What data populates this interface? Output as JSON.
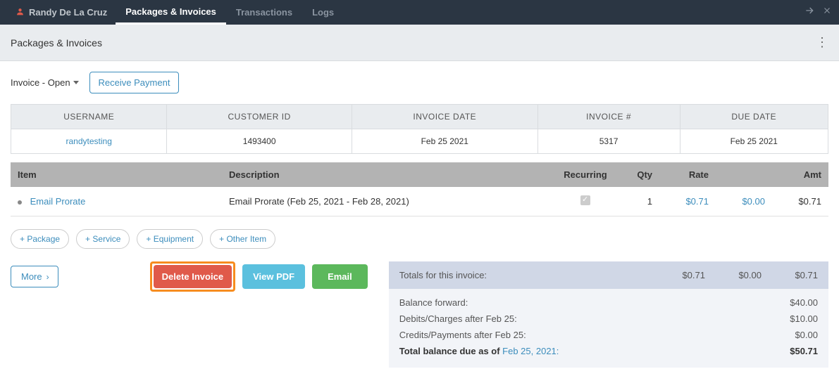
{
  "nav": {
    "user_name": "Randy De La Cruz",
    "tabs": [
      "Packages & Invoices",
      "Transactions",
      "Logs"
    ],
    "active_index": 0
  },
  "subheader": {
    "title": "Packages & Invoices"
  },
  "toolbar": {
    "status_label": "Invoice - Open",
    "receive_payment_label": "Receive Payment"
  },
  "info": {
    "headers": [
      "USERNAME",
      "CUSTOMER ID",
      "INVOICE DATE",
      "INVOICE #",
      "DUE DATE"
    ],
    "username": "randytesting",
    "customer_id": "1493400",
    "invoice_date": "Feb 25 2021",
    "invoice_number": "5317",
    "due_date": "Feb 25 2021"
  },
  "items": {
    "headers": {
      "item": "Item",
      "description": "Description",
      "recurring": "Recurring",
      "qty": "Qty",
      "rate": "Rate",
      "blank": "",
      "amt": "Amt"
    },
    "rows": [
      {
        "item": "Email Prorate",
        "description": "Email Prorate (Feb 25, 2021 - Feb 28, 2021)",
        "recurring": true,
        "qty": "1",
        "rate": "$0.71",
        "extra": "$0.00",
        "amt": "$0.71"
      }
    ]
  },
  "add_buttons": [
    "+ Package",
    "+ Service",
    "+ Equipment",
    "+ Other Item"
  ],
  "actions": {
    "more": "More",
    "delete_invoice": "Delete Invoice",
    "view_pdf": "View PDF",
    "email": "Email"
  },
  "totals": {
    "header_label": "Totals for this invoice:",
    "header_cols": [
      "$0.71",
      "$0.00",
      "$0.71"
    ],
    "rows": [
      {
        "label": "Balance forward:",
        "value": "$40.00"
      },
      {
        "label": "Debits/Charges after Feb 25:",
        "value": "$10.00"
      },
      {
        "label": "Credits/Payments after Feb 25:",
        "value": "$0.00"
      }
    ],
    "final_label_prefix": "Total balance due as of ",
    "final_date": "Feb 25, 2021:",
    "final_value": "$50.71"
  }
}
